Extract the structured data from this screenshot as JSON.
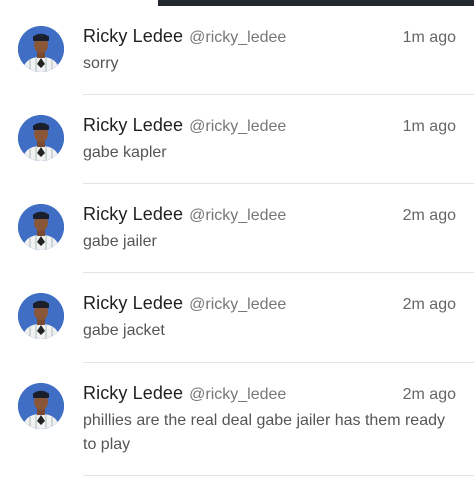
{
  "feed": {
    "tweets": [
      {
        "name": "Ricky Ledee",
        "handle": "@ricky_ledee",
        "time": "1m ago",
        "text": "sorry"
      },
      {
        "name": "Ricky Ledee",
        "handle": "@ricky_ledee",
        "time": "1m ago",
        "text": "gabe kapler"
      },
      {
        "name": "Ricky Ledee",
        "handle": "@ricky_ledee",
        "time": "2m ago",
        "text": "gabe jailer"
      },
      {
        "name": "Ricky Ledee",
        "handle": "@ricky_ledee",
        "time": "2m ago",
        "text": "gabe jacket"
      },
      {
        "name": "Ricky Ledee",
        "handle": "@ricky_ledee",
        "time": "2m ago",
        "text": "phillies are the real deal gabe jailer has them ready to play"
      }
    ]
  },
  "colors": {
    "avatar_bg": "#3f6ec4",
    "top_bar": "#24292f"
  }
}
